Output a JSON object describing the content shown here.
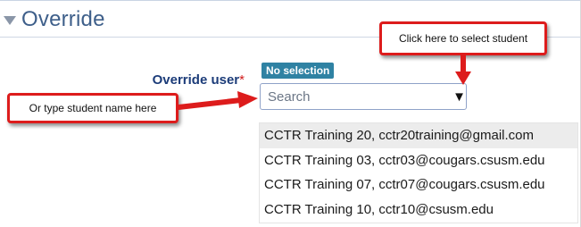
{
  "section": {
    "title": "Override",
    "collapse_icon": "chevron-down-icon"
  },
  "field": {
    "label": "Override user",
    "required_mark": "*"
  },
  "selection_badge": "No selection",
  "search": {
    "placeholder": "Search",
    "value": "",
    "caret": "▼"
  },
  "suggestions": [
    {
      "text": "CCTR Training 20, cctr20training@gmail.com",
      "active": true
    },
    {
      "text": "CCTR Training 03, cctr03@cougars.csusm.edu",
      "active": false
    },
    {
      "text": "CCTR Training 07, cctr07@cougars.csusm.edu",
      "active": false
    },
    {
      "text": "CCTR Training 10, cctr10@csusm.edu",
      "active": false
    }
  ],
  "callouts": {
    "select_student": "Click here to select student",
    "type_student": "Or type student name here"
  },
  "colors": {
    "callout_border": "#dd1c1c",
    "badge": "#2f82a3",
    "title": "#3e5f8a",
    "label": "#1c3c79",
    "active_row": "#ececec"
  }
}
